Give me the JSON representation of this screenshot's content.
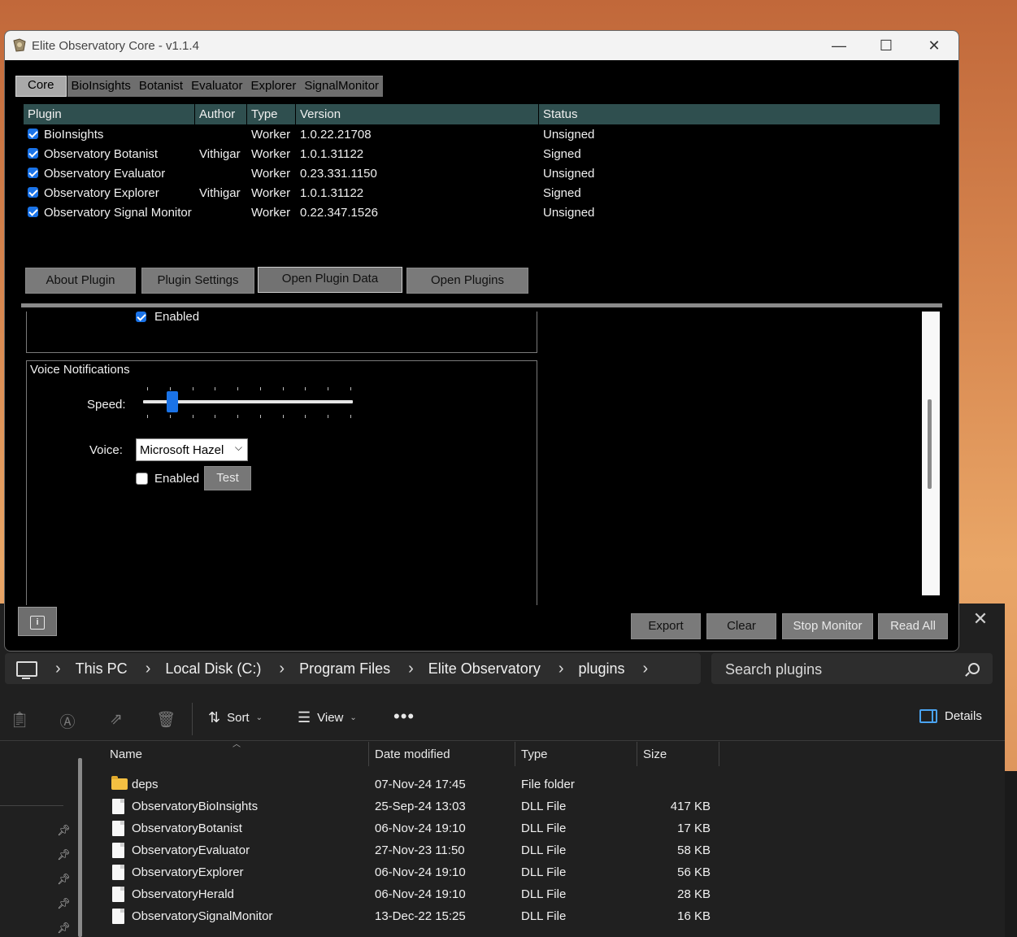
{
  "observatory": {
    "title": "Elite Observatory Core - v1.1.4",
    "window_controls": {
      "minimize": "—",
      "maximize": "☐",
      "close": "✕"
    },
    "tabs": [
      "Core",
      "BioInsights",
      "Botanist",
      "Evaluator",
      "Explorer",
      "SignalMonitor"
    ],
    "active_tab": "Core",
    "plugin_grid": {
      "columns": [
        "Plugin",
        "Author",
        "Type",
        "Version",
        "Status"
      ],
      "rows": [
        {
          "enabled": true,
          "plugin": "BioInsights",
          "author": "",
          "type": "Worker",
          "version": "1.0.22.21708",
          "status": "Unsigned"
        },
        {
          "enabled": true,
          "plugin": "Observatory Botanist",
          "author": "Vithigar",
          "type": "Worker",
          "version": "1.0.1.31122",
          "status": "Signed"
        },
        {
          "enabled": true,
          "plugin": "Observatory Evaluator",
          "author": "",
          "type": "Worker",
          "version": "0.23.331.1150",
          "status": "Unsigned"
        },
        {
          "enabled": true,
          "plugin": "Observatory Explorer",
          "author": "Vithigar",
          "type": "Worker",
          "version": "1.0.1.31122",
          "status": "Signed"
        },
        {
          "enabled": true,
          "plugin": "Observatory Signal Monitor",
          "author": "",
          "type": "Worker",
          "version": "0.22.347.1526",
          "status": "Unsigned"
        }
      ]
    },
    "plugin_buttons": {
      "about": "About Plugin",
      "settings": "Plugin Settings",
      "open_data": "Open Plugin Data",
      "open_plugins": "Open Plugins"
    },
    "settings": {
      "upper_enabled_label": "Enabled",
      "upper_enabled_checked": true,
      "voice_group_title": "Voice Notifications",
      "speed_label": "Speed:",
      "speed_level": 0.13,
      "voice_label": "Voice:",
      "voice_value": "Microsoft Hazel",
      "voice_enabled_label": "Enabled",
      "voice_enabled_checked": false,
      "test_label": "Test"
    },
    "bottom_buttons": {
      "export": "Export",
      "clear": "Clear",
      "stop_monitor": "Stop Monitor",
      "read_all": "Read All"
    }
  },
  "explorer": {
    "breadcrumb": [
      "This PC",
      "Local Disk (C:)",
      "Program Files",
      "Elite Observatory",
      "plugins"
    ],
    "search_placeholder": "Search plugins",
    "commands": {
      "sort": "Sort",
      "view": "View",
      "more": "•••",
      "details": "Details"
    },
    "columns": {
      "name": "Name",
      "date": "Date modified",
      "type": "Type",
      "size": "Size"
    },
    "files": [
      {
        "icon": "folder-icon",
        "name": "deps",
        "date": "07-Nov-24 17:45",
        "type": "File folder",
        "size": ""
      },
      {
        "icon": "file-icon",
        "name": "ObservatoryBioInsights",
        "date": "25-Sep-24 13:03",
        "type": "DLL File",
        "size": "417 KB"
      },
      {
        "icon": "file-icon",
        "name": "ObservatoryBotanist",
        "date": "06-Nov-24 19:10",
        "type": "DLL File",
        "size": "17 KB"
      },
      {
        "icon": "file-icon",
        "name": "ObservatoryEvaluator",
        "date": "27-Nov-23 11:50",
        "type": "DLL File",
        "size": "58 KB"
      },
      {
        "icon": "file-icon",
        "name": "ObservatoryExplorer",
        "date": "06-Nov-24 19:10",
        "type": "DLL File",
        "size": "56 KB"
      },
      {
        "icon": "file-icon",
        "name": "ObservatoryHerald",
        "date": "06-Nov-24 19:10",
        "type": "DLL File",
        "size": "28 KB"
      },
      {
        "icon": "file-icon",
        "name": "ObservatorySignalMonitor",
        "date": "13-Dec-22 15:25",
        "type": "DLL File",
        "size": "16 KB"
      }
    ]
  },
  "colors": {
    "grid_header": "#2f4f4f",
    "accent_blue": "#1a73e8",
    "folder_yellow": "#f4c042"
  }
}
